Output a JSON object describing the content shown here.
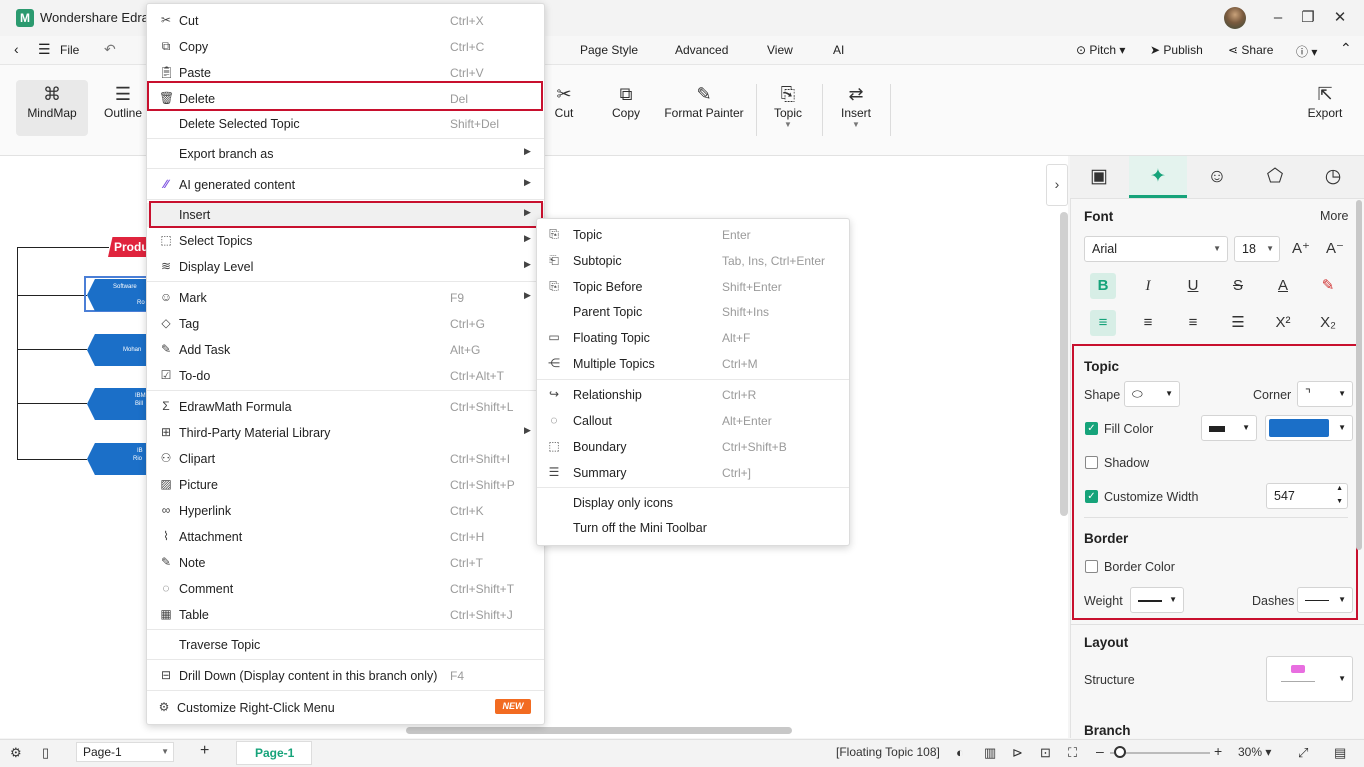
{
  "titlebar": {
    "logo": "M",
    "title": "Wondershare Edraw"
  },
  "menubar": {
    "file": "File",
    "items": [
      "Page Style",
      "Advanced",
      "View",
      "AI"
    ],
    "pitch": "Pitch",
    "publish": "Publish",
    "share": "Share"
  },
  "ribbon": {
    "left": [
      {
        "label": "MindMap",
        "icon": "mindmap-icon"
      },
      {
        "label": "Outline",
        "icon": "outline-icon"
      }
    ],
    "tools": [
      {
        "label": "Cut"
      },
      {
        "label": "Copy"
      },
      {
        "label": "Format Painter"
      },
      {
        "label": "Topic"
      },
      {
        "label": "Insert"
      }
    ],
    "export": "Export"
  },
  "canvas": {
    "label": "Produ",
    "nodes": [
      {
        "line1": "Software",
        "line2": "Ro"
      },
      {
        "line1": "Mohan",
        "line2": ""
      },
      {
        "line1": "IBM",
        "line2": "Bill"
      },
      {
        "line1": "IB",
        "line2": "Rio"
      }
    ]
  },
  "context_menu": {
    "items": [
      {
        "label": "Cut",
        "shortcut": "Ctrl+X",
        "icon": "scissors-icon"
      },
      {
        "label": "Copy",
        "shortcut": "Ctrl+C",
        "icon": "copy-icon"
      },
      {
        "label": "Paste",
        "shortcut": "Ctrl+V",
        "icon": "paste-icon"
      },
      {
        "label": "Delete",
        "shortcut": "Del",
        "icon": "trash-icon"
      },
      {
        "label": "Delete Selected Topic",
        "shortcut": "Shift+Del",
        "icon": ""
      },
      {
        "label": "Export branch as",
        "shortcut": "",
        "icon": ""
      },
      {
        "label": "AI generated content",
        "shortcut": "",
        "icon": "ai-icon"
      },
      {
        "label": "Insert",
        "shortcut": "",
        "icon": ""
      },
      {
        "label": "Select Topics",
        "shortcut": "",
        "icon": "select-icon"
      },
      {
        "label": "Display Level",
        "shortcut": "",
        "icon": "layers-icon"
      },
      {
        "label": "Mark",
        "shortcut": "F9",
        "icon": "mark-icon"
      },
      {
        "label": "Tag",
        "shortcut": "Ctrl+G",
        "icon": "tag-icon"
      },
      {
        "label": "Add Task",
        "shortcut": "Alt+G",
        "icon": "task-icon"
      },
      {
        "label": "To-do",
        "shortcut": "Ctrl+Alt+T",
        "icon": "todo-icon"
      },
      {
        "label": "EdrawMath Formula",
        "shortcut": "Ctrl+Shift+L",
        "icon": "formula-icon"
      },
      {
        "label": "Third-Party Material Library",
        "shortcut": "",
        "icon": "library-icon"
      },
      {
        "label": "Clipart",
        "shortcut": "Ctrl+Shift+I",
        "icon": "clipart-icon"
      },
      {
        "label": "Picture",
        "shortcut": "Ctrl+Shift+P",
        "icon": "picture-icon"
      },
      {
        "label": "Hyperlink",
        "shortcut": "Ctrl+K",
        "icon": "link-icon"
      },
      {
        "label": "Attachment",
        "shortcut": "Ctrl+H",
        "icon": "attachment-icon"
      },
      {
        "label": "Note",
        "shortcut": "Ctrl+T",
        "icon": "note-icon"
      },
      {
        "label": "Comment",
        "shortcut": "Ctrl+Shift+T",
        "icon": "comment-icon"
      },
      {
        "label": "Table",
        "shortcut": "Ctrl+Shift+J",
        "icon": "table-icon"
      },
      {
        "label": "Traverse Topic",
        "shortcut": "",
        "icon": ""
      },
      {
        "label": "Drill Down (Display content in this branch only)",
        "shortcut": "F4",
        "icon": "drill-icon"
      },
      {
        "label": "Customize Right-Click Menu",
        "shortcut": "",
        "icon": "gear-icon"
      }
    ],
    "new_badge": "NEW"
  },
  "insert_submenu": {
    "items": [
      {
        "label": "Topic",
        "shortcut": "Enter"
      },
      {
        "label": "Subtopic",
        "shortcut": "Tab, Ins, Ctrl+Enter"
      },
      {
        "label": "Topic Before",
        "shortcut": "Shift+Enter"
      },
      {
        "label": "Parent Topic",
        "shortcut": "Shift+Ins"
      },
      {
        "label": "Floating Topic",
        "shortcut": "Alt+F"
      },
      {
        "label": "Multiple Topics",
        "shortcut": "Ctrl+M"
      },
      {
        "label": "Relationship",
        "shortcut": "Ctrl+R"
      },
      {
        "label": "Callout",
        "shortcut": "Alt+Enter"
      },
      {
        "label": "Boundary",
        "shortcut": "Ctrl+Shift+B"
      },
      {
        "label": "Summary",
        "shortcut": "Ctrl+]"
      },
      {
        "label": "Display only icons",
        "shortcut": ""
      },
      {
        "label": "Turn off the Mini Toolbar",
        "shortcut": ""
      }
    ]
  },
  "panel": {
    "font": {
      "title": "Font",
      "more": "More",
      "family": "Arial",
      "size": "18"
    },
    "topic": {
      "title": "Topic",
      "shape": "Shape",
      "corner": "Corner",
      "fill_color": "Fill Color",
      "shadow": "Shadow",
      "customize_width": "Customize Width",
      "width_value": "547",
      "fill_hex": "#1b6fc8"
    },
    "border": {
      "title": "Border",
      "border_color": "Border Color",
      "weight": "Weight",
      "dashes": "Dashes"
    },
    "layout": {
      "title": "Layout",
      "structure": "Structure"
    },
    "branch": {
      "title": "Branch"
    }
  },
  "status": {
    "page_selector": "Page-1",
    "page_tab": "Page-1",
    "selection": "[Floating Topic 108]",
    "zoom": "30%"
  },
  "colors": {
    "accent": "#16a37a",
    "highlight": "#c8102e",
    "node": "#1b6fc8",
    "label": "#e0243d"
  }
}
